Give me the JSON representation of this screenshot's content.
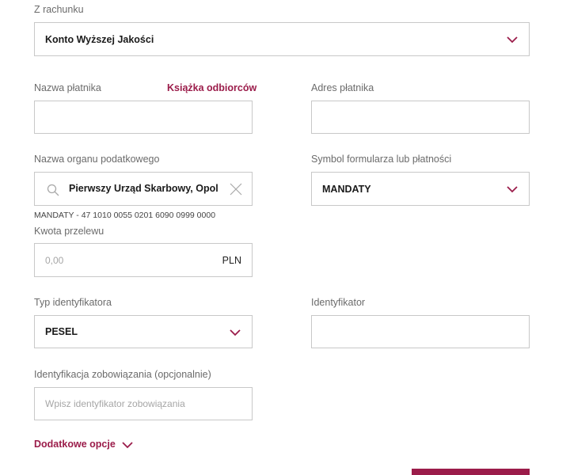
{
  "source_account": {
    "label": "Z rachunku",
    "value": "Konto Wyższej Jakości"
  },
  "payer_name": {
    "label": "Nazwa płatnika",
    "address_book_link": "Książka odbiorców",
    "value": ""
  },
  "payer_address": {
    "label": "Adres płatnika",
    "value": ""
  },
  "tax_office": {
    "label": "Nazwa organu podatkowego",
    "value": "Pierwszy Urząd Skarbowy, Opol",
    "account_info": "MANDATY - 47 1010 0055 0201 6090 0999 0000"
  },
  "form_symbol": {
    "label": "Symbol formularza lub płatności",
    "value": "MANDATY"
  },
  "amount": {
    "label": "Kwota przelewu",
    "placeholder": "0,00",
    "currency": "PLN"
  },
  "id_type": {
    "label": "Typ identyfikatora",
    "value": "PESEL"
  },
  "identifier": {
    "label": "Identyfikator",
    "value": ""
  },
  "obligation_id": {
    "label": "Identyfikacja zobowiązania (opcjonalnie)",
    "placeholder": "Wpisz identyfikator zobowiązania"
  },
  "extra_options": {
    "label": "Dodatkowe opcje"
  },
  "colors": {
    "accent": "#9b1c4a",
    "border": "#c8c8c8",
    "label": "#6b6b6b"
  }
}
